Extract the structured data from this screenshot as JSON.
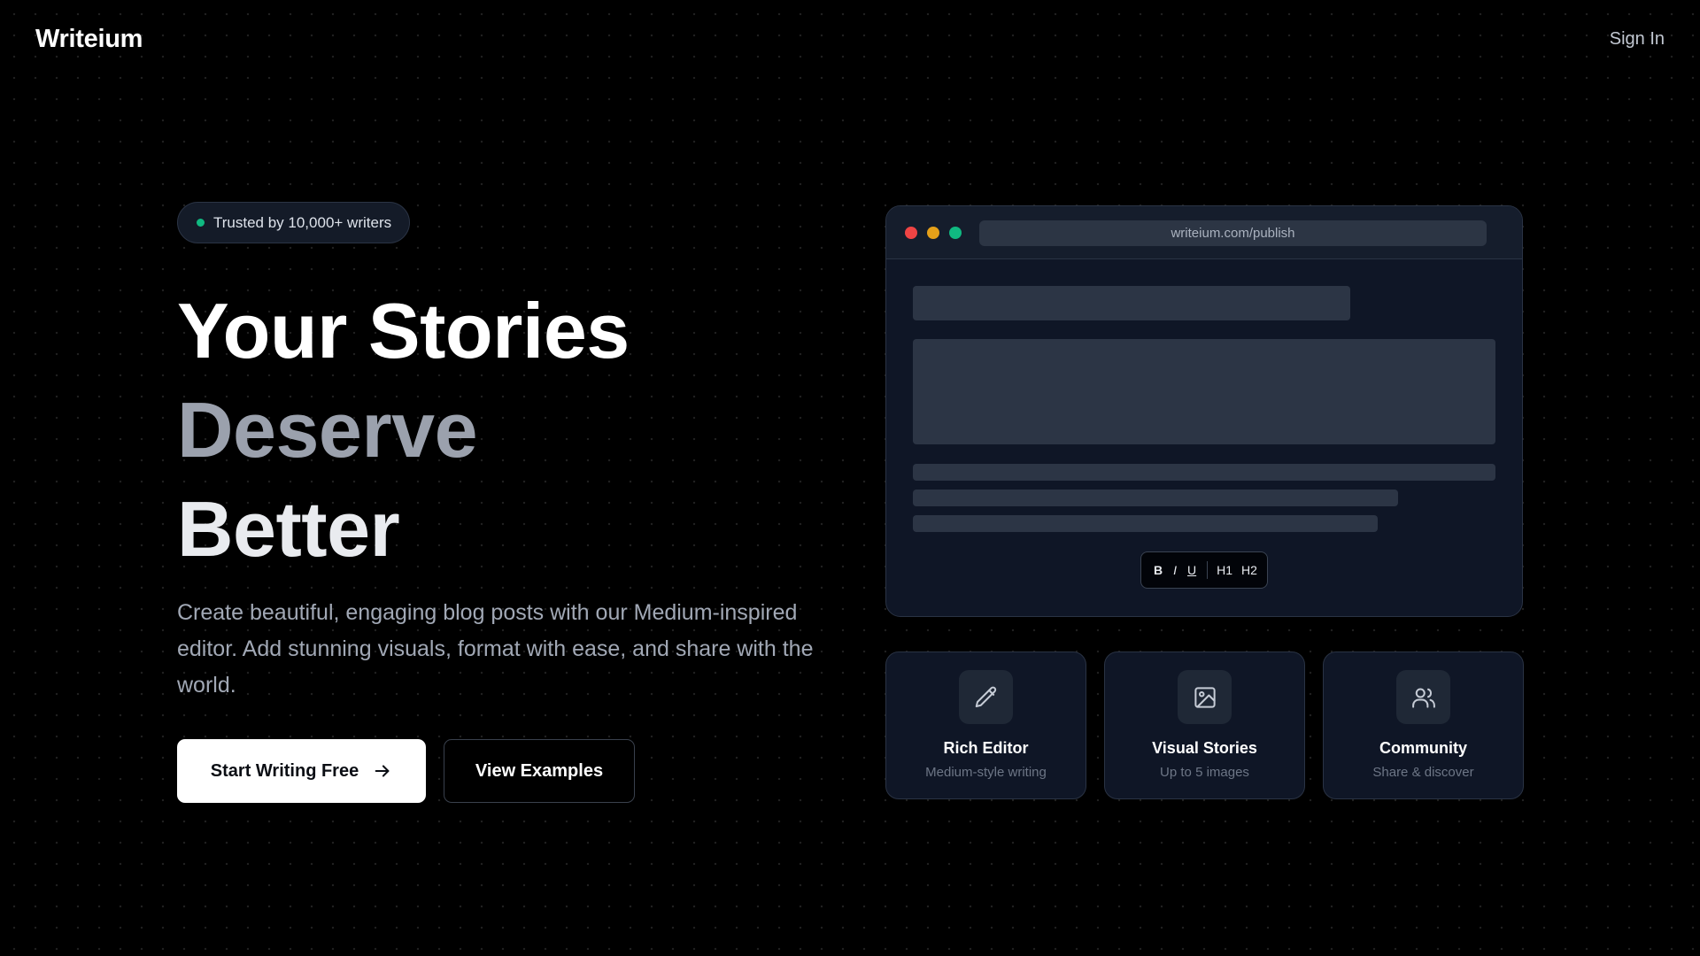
{
  "header": {
    "logo": "Writeium",
    "signin_label": "Sign In"
  },
  "hero": {
    "badge_text": "Trusted by 10,000+ writers",
    "headline": [
      "Your Stories",
      "Deserve",
      "Better"
    ],
    "subtext": "Create beautiful, engaging blog posts with our Medium-inspired editor. Add stunning visuals, format with ease, and share with the world.",
    "primary_button": "Start Writing Free",
    "secondary_button": "View Examples"
  },
  "mockup": {
    "url": "writeium.com/publish",
    "toolbar": {
      "bold": "B",
      "italic": "I",
      "underline": "U",
      "h1": "H1",
      "h2": "H2"
    }
  },
  "features": [
    {
      "icon": "pencil-icon",
      "title": "Rich Editor",
      "subtitle": "Medium-style writing"
    },
    {
      "icon": "image-icon",
      "title": "Visual Stories",
      "subtitle": "Up to 5 images"
    },
    {
      "icon": "users-icon",
      "title": "Community",
      "subtitle": "Share & discover"
    }
  ],
  "colors": {
    "background": "#000000",
    "accent_green": "#10b981",
    "traffic_red": "#ef4444",
    "traffic_yellow": "#e5a019",
    "traffic_green": "#10b981",
    "card_bg": "#0f1626",
    "headline_muted": "#9ba1ad"
  }
}
